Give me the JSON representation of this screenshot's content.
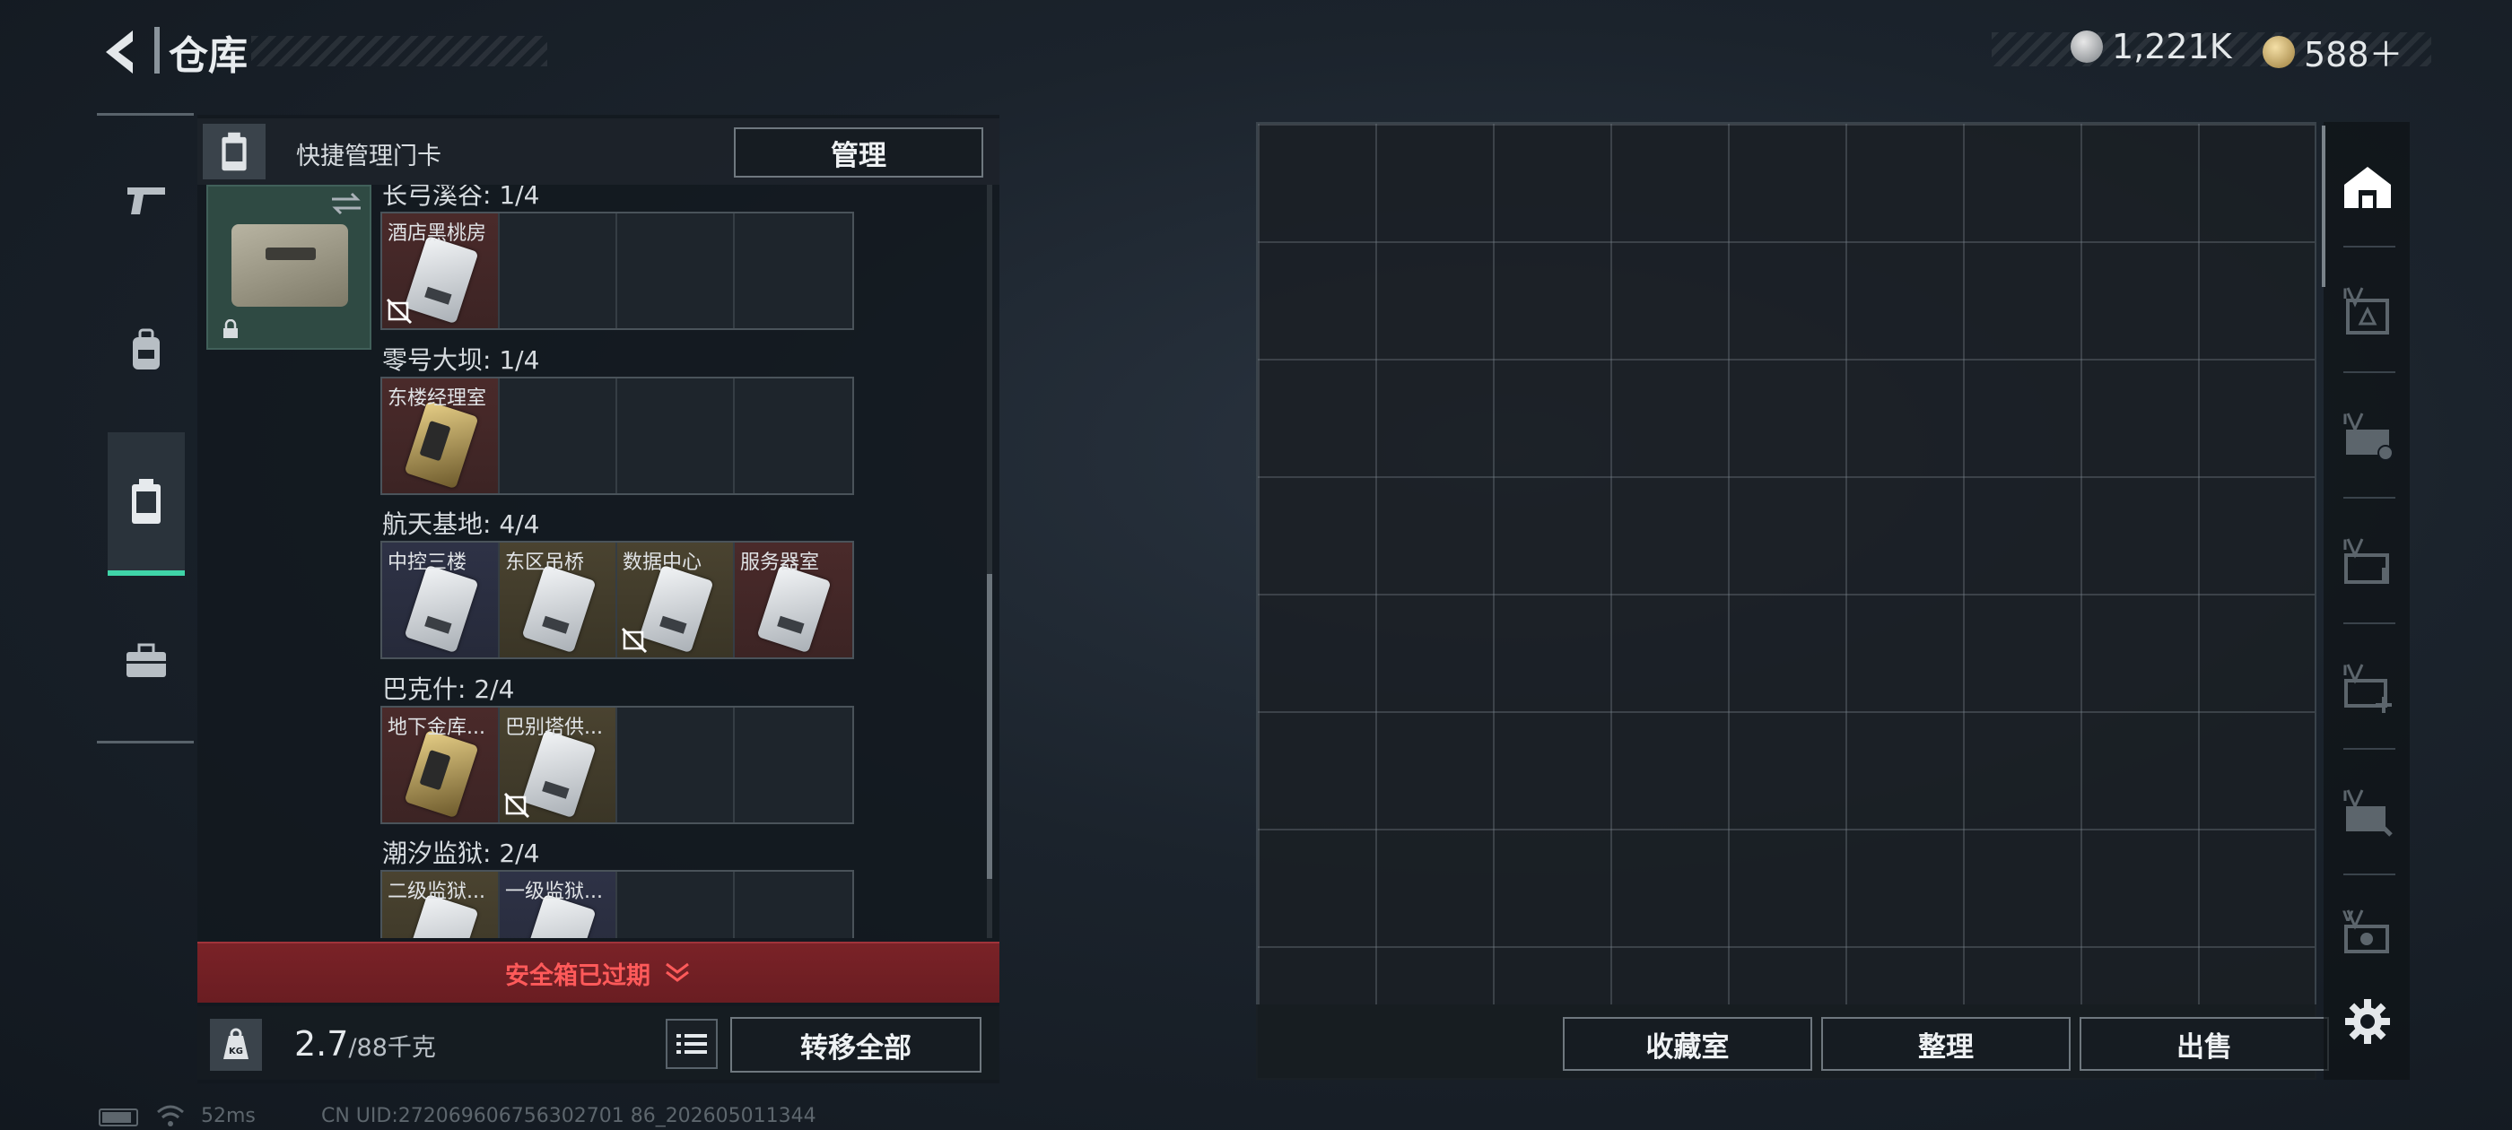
{
  "header": {
    "title": "仓库",
    "currency": [
      {
        "icon": "silver-coin-icon",
        "value": "1,221K"
      },
      {
        "icon": "gold-coin-icon",
        "value": "588＋"
      }
    ]
  },
  "left_rail": {
    "items": [
      {
        "name": "weapons",
        "icon": "pistol-icon"
      },
      {
        "name": "equipment",
        "icon": "backpack-icon"
      },
      {
        "name": "keycards",
        "icon": "keycard-case-icon",
        "active": true
      },
      {
        "name": "items",
        "icon": "toolbox-icon"
      }
    ]
  },
  "panel": {
    "header_text": "快捷管理门卡",
    "manage_label": "管理",
    "groups": [
      {
        "label": "长弓溪谷: 1/4",
        "cells": [
          {
            "name": "酒店黑桃房",
            "tint": "red",
            "card": "white",
            "no_trade": true
          },
          null,
          null,
          null
        ]
      },
      {
        "label": "零号大坝: 1/4",
        "cells": [
          {
            "name": "东楼经理室",
            "tint": "red",
            "card": "gold",
            "no_trade": false
          },
          null,
          null,
          null
        ]
      },
      {
        "label": "航天基地: 4/4",
        "cells": [
          {
            "name": "中控三楼",
            "tint": "blue",
            "card": "white",
            "no_trade": false
          },
          {
            "name": "东区吊桥",
            "tint": "olive",
            "card": "white",
            "no_trade": false
          },
          {
            "name": "数据中心",
            "tint": "olive",
            "card": "white",
            "no_trade": true
          },
          {
            "name": "服务器室",
            "tint": "red",
            "card": "white",
            "no_trade": false
          }
        ]
      },
      {
        "label": "巴克什: 2/4",
        "cells": [
          {
            "name": "地下金库...",
            "tint": "red",
            "card": "gold",
            "no_trade": false
          },
          {
            "name": "巴别塔供...",
            "tint": "olive",
            "card": "white",
            "no_trade": true
          },
          null,
          null
        ]
      },
      {
        "label": "潮汐监狱: 2/4",
        "cells": [
          {
            "name": "二级监狱...",
            "tint": "olive",
            "card": "white",
            "no_trade": false
          },
          {
            "name": "一级监狱...",
            "tint": "blue",
            "card": "white",
            "no_trade": false
          },
          null,
          null
        ]
      }
    ],
    "expired_text": "安全箱已过期",
    "weight_value": "2.7",
    "weight_max": "/88千克",
    "kg_label": "KG",
    "transfer_label": "转移全部"
  },
  "storage": {
    "buttons": [
      "收藏室",
      "整理",
      "出售"
    ]
  },
  "right_rail": {
    "items": [
      {
        "icon": "storage-home-icon",
        "active": true
      },
      {
        "icon": "storage-tab-1-icon"
      },
      {
        "icon": "storage-tab-2-icon"
      },
      {
        "icon": "storage-tab-3-icon"
      },
      {
        "icon": "storage-tab-4-icon"
      },
      {
        "icon": "storage-tab-5-icon"
      },
      {
        "icon": "storage-tab-6-icon"
      }
    ],
    "settings_icon": "gear-icon"
  },
  "status_bar": {
    "ping": "52ms",
    "uid": "CN UID:272069606756302701 86_202605011344"
  }
}
